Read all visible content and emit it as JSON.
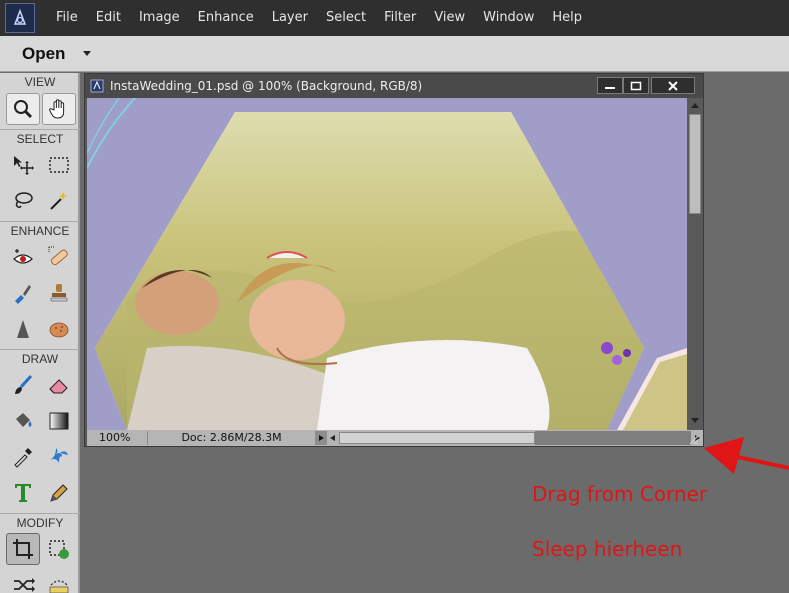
{
  "menu": {
    "items": [
      "File",
      "Edit",
      "Image",
      "Enhance",
      "Layer",
      "Select",
      "Filter",
      "View",
      "Window",
      "Help"
    ]
  },
  "options_bar": {
    "open_label": "Open"
  },
  "toolbox": {
    "sections": {
      "view": "VIEW",
      "select": "SELECT",
      "enhance": "ENHANCE",
      "draw": "DRAW",
      "modify": "MODIFY"
    }
  },
  "document": {
    "title": "InstaWedding_01.psd @ 100% (Background, RGB/8)",
    "zoom": "100%",
    "doc_info": "Doc: 2.86M/28.3M"
  },
  "annotations": {
    "english": "Drag from Corner",
    "dutch": "Sleep hierheen",
    "color": "#e01515"
  },
  "colors": {
    "canvas_bg": "#a09dc9",
    "menubar_bg": "#2f2f2f",
    "toolbox_bg": "#d4d4d4"
  }
}
